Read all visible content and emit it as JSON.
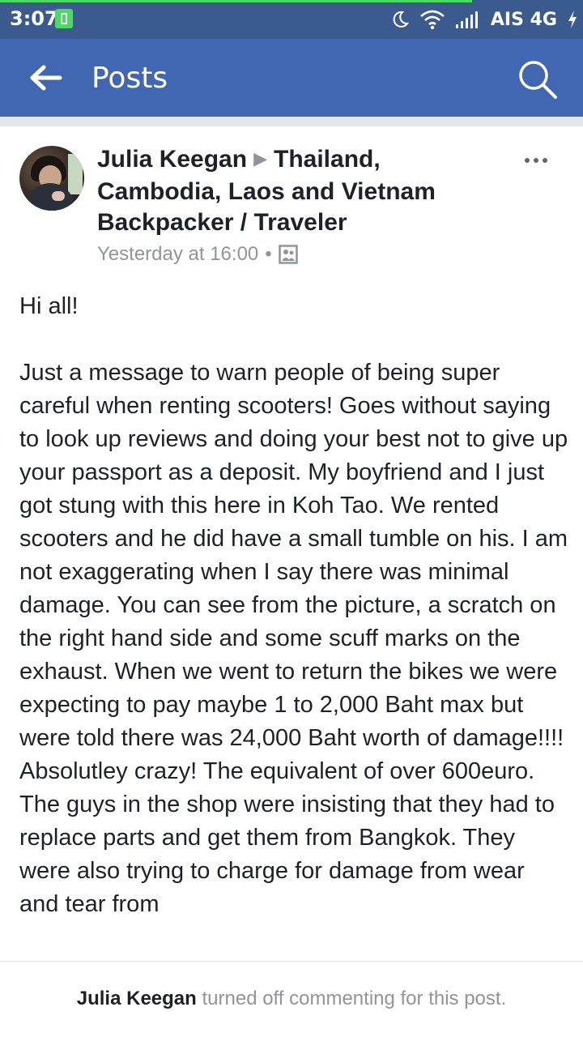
{
  "status_bar": {
    "time": "3:07",
    "carrier": "AIS 4G",
    "icons": [
      "battery-saver-icon",
      "moon-icon",
      "wifi-icon",
      "signal-icon",
      "charging-icon"
    ],
    "colors": {
      "background": "#3b5b8f",
      "progress": "#4cd964"
    },
    "loading_progress": 0.81
  },
  "header": {
    "title": "Posts",
    "back_icon": "back-arrow-icon",
    "search_icon": "search-icon",
    "color": "#4267b2"
  },
  "post": {
    "author": "Julia Keegan",
    "group": "Thailand, Cambodia, Laos and Vietnam Backpacker / Traveler",
    "timestamp": "Yesterday at 16:00",
    "separator": "•",
    "audience_icon": "group-icon",
    "more_icon": "more-options-icon",
    "greeting": "Hi all!",
    "body": "Just a message to warn people of being super careful when renting scooters! Goes without saying to look up reviews and doing your best not to give up your passport as a deposit. My boyfriend and I just got stung with this here in Koh Tao. We rented scooters and he did have a small tumble on his. I am not exaggerating when I say there was minimal damage. You can see from the picture, a scratch on the right hand side and some scuff marks on the exhaust. When we went to return the bikes we were expecting to pay maybe 1 to 2,000 Baht max but were told there was 24,000 Baht worth of damage!!!! Absolutley crazy! The equivalent of over 600euro. The guys in the shop were insisting that they had to replace parts and get them from Bangkok. They were also trying to charge for damage from wear and tear from"
  },
  "footer": {
    "name": "Julia Keegan",
    "message": "turned off commenting for this post."
  }
}
